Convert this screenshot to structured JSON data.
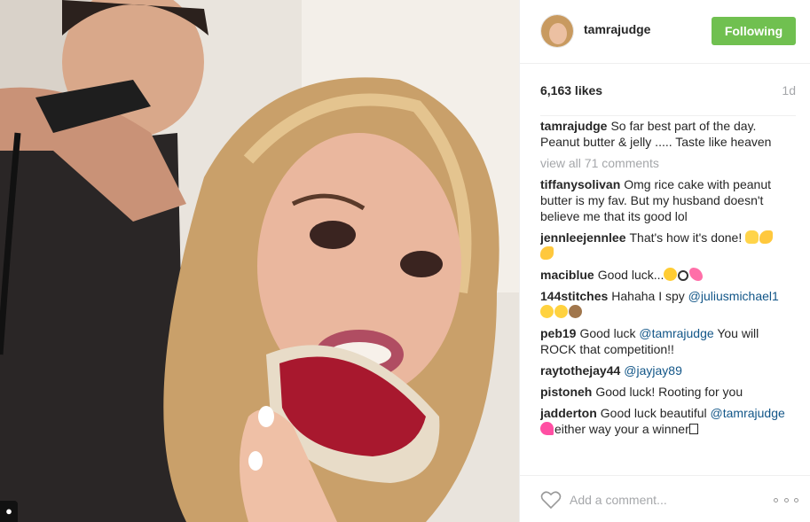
{
  "post": {
    "username": "tamrajudge",
    "follow_label": "Following",
    "likes": "6,163 likes",
    "age": "1d",
    "caption": {
      "user": "tamrajudge",
      "text": "So far best part of the day. Peanut butter & jelly ..... Taste like heaven"
    },
    "view_all": "view all 71 comments",
    "comments": [
      {
        "user": "tiffanysolivan",
        "text": "Omg rice cake with peanut butter is my fav. But my husband doesn't believe me that its good lol"
      },
      {
        "user": "jennleejennlee",
        "text": "That's how it's done!"
      },
      {
        "user": "maciblue",
        "text": "Good luck..."
      },
      {
        "user": "144stitches",
        "text": "Hahaha I spy",
        "mention": "@juliusmichael1"
      },
      {
        "user": "peb19",
        "text": "Good luck",
        "mention": "@tamrajudge",
        "text2": "You will ROCK that competition!!"
      },
      {
        "user": "raytothejay44",
        "mention": "@jayjay89"
      },
      {
        "user": "pistoneh",
        "text": "Good luck! Rooting for you"
      },
      {
        "user": "jadderton",
        "text": "Good luck beautiful",
        "mention": "@tamrajudge",
        "text2": "either way your a winner"
      }
    ],
    "add_comment_placeholder": "Add a comment...",
    "colors": {
      "follow": "#70c050",
      "mention": "#125688",
      "muted": "#a5a7aa"
    },
    "icons": {
      "like": "heart-outline-icon",
      "more": "more-options-icon",
      "tag": "user-tag-icon"
    }
  }
}
